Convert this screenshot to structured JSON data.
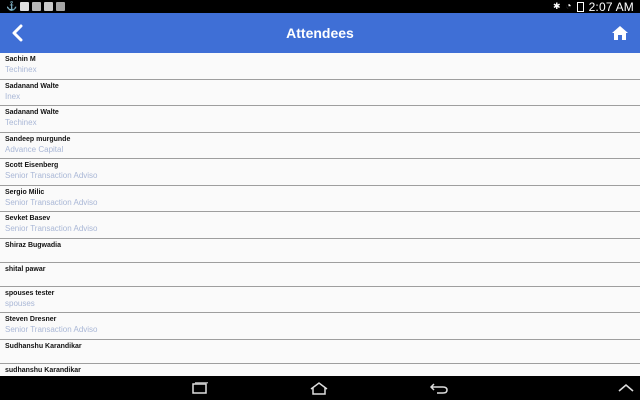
{
  "status_bar": {
    "time": "2:07 AM"
  },
  "app_bar": {
    "title": "Attendees"
  },
  "attendees": [
    {
      "name": "Sachin M",
      "company": "Techinex"
    },
    {
      "name": "Sadanand Walte",
      "company": "Inex"
    },
    {
      "name": "Sadanand Walte",
      "company": "Techinex"
    },
    {
      "name": "Sandeep murgunde",
      "company": "Advance Capital"
    },
    {
      "name": "Scott Eisenberg",
      "company": "Senior Transaction Adviso"
    },
    {
      "name": "Sergio Milic",
      "company": "Senior Transaction Adviso"
    },
    {
      "name": "Sevket Basev",
      "company": "Senior Transaction Adviso"
    },
    {
      "name": "Shiraz Bugwadia",
      "company": ""
    },
    {
      "name": "shital pawar",
      "company": ""
    },
    {
      "name": "spouses tester",
      "company": "spouses"
    },
    {
      "name": "Steven Dresner",
      "company": "Senior Transaction Adviso"
    },
    {
      "name": "Sudhanshu Karandikar",
      "company": ""
    },
    {
      "name": "sudhanshu Karandikar",
      "company": ""
    }
  ],
  "colors": {
    "app_bar": "#3f6fd6",
    "company_text": "#a9b7d6",
    "divider": "#9e9e9e"
  }
}
